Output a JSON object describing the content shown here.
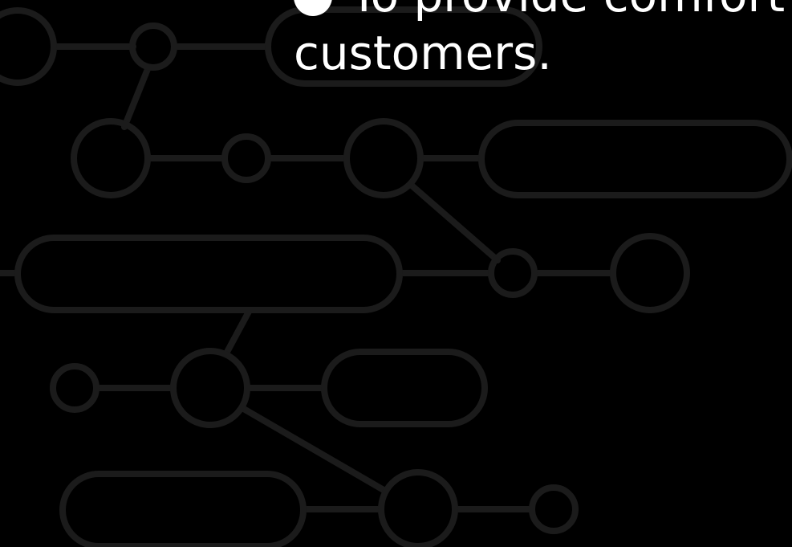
{
  "slide": {
    "bullet": {
      "line1": "To provide comfort",
      "line2": "customers."
    }
  },
  "colors": {
    "background": "#000000",
    "pattern_stroke": "#1b1b1b",
    "text": "#ffffff"
  }
}
